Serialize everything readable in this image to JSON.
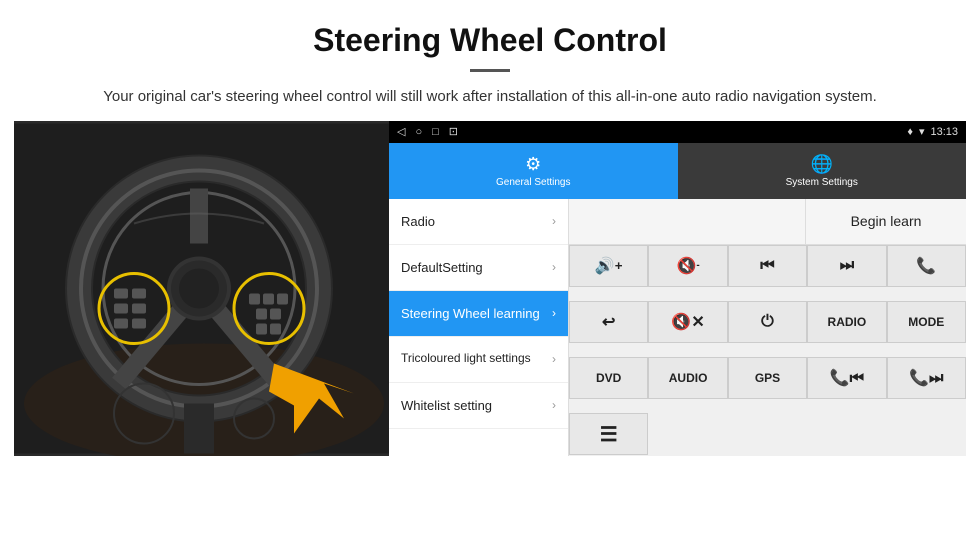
{
  "header": {
    "title": "Steering Wheel Control",
    "description": "Your original car's steering wheel control will still work after installation of this all-in-one auto radio navigation system."
  },
  "status_bar": {
    "back_icon": "◁",
    "home_icon": "○",
    "recent_icon": "□",
    "screenshot_icon": "⊡",
    "signal_icon": "▲",
    "wifi_icon": "▾",
    "time": "13:13"
  },
  "tabs": [
    {
      "id": "general",
      "label": "General Settings",
      "icon": "⚙",
      "active": true
    },
    {
      "id": "system",
      "label": "System Settings",
      "icon": "🌐",
      "active": false
    }
  ],
  "menu_items": [
    {
      "id": "radio",
      "label": "Radio",
      "active": false
    },
    {
      "id": "default",
      "label": "DefaultSetting",
      "active": false
    },
    {
      "id": "steering",
      "label": "Steering Wheel learning",
      "active": true
    },
    {
      "id": "tricoloured",
      "label": "Tricoloured light settings",
      "active": false
    },
    {
      "id": "whitelist",
      "label": "Whitelist setting",
      "active": false
    }
  ],
  "controls": {
    "begin_learn_label": "Begin learn",
    "buttons_row1": [
      {
        "id": "vol-up",
        "label": "🔊+",
        "type": "icon"
      },
      {
        "id": "vol-down",
        "label": "🔇-",
        "type": "icon"
      },
      {
        "id": "prev-track",
        "label": "⏮",
        "type": "icon"
      },
      {
        "id": "next-track",
        "label": "⏭",
        "type": "icon"
      },
      {
        "id": "phone",
        "label": "📞",
        "type": "icon"
      }
    ],
    "buttons_row2": [
      {
        "id": "hang-up",
        "label": "↩",
        "type": "icon"
      },
      {
        "id": "mute",
        "label": "🔇×",
        "type": "icon"
      },
      {
        "id": "power",
        "label": "⏻",
        "type": "icon"
      },
      {
        "id": "radio-btn",
        "label": "RADIO",
        "type": "text"
      },
      {
        "id": "mode",
        "label": "MODE",
        "type": "text"
      }
    ],
    "buttons_row3": [
      {
        "id": "dvd",
        "label": "DVD",
        "type": "text"
      },
      {
        "id": "audio",
        "label": "AUDIO",
        "type": "text"
      },
      {
        "id": "gps",
        "label": "GPS",
        "type": "text"
      },
      {
        "id": "tel-prev",
        "label": "📞⏮",
        "type": "icon"
      },
      {
        "id": "tel-next",
        "label": "📞⏭",
        "type": "icon"
      }
    ],
    "buttons_row4": [
      {
        "id": "list",
        "label": "≡",
        "type": "icon"
      }
    ]
  }
}
